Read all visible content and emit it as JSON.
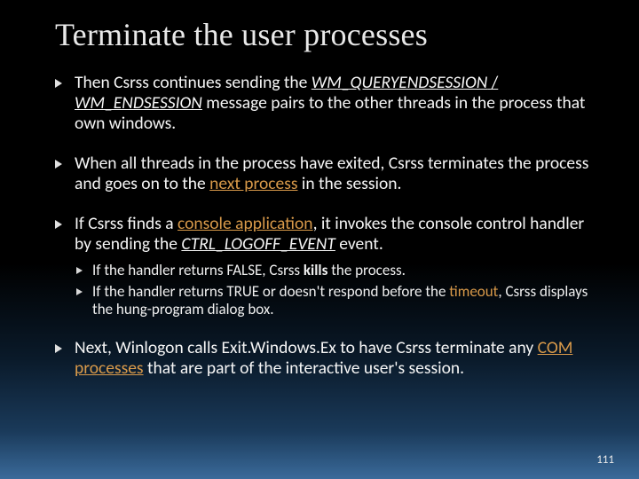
{
  "title": "Terminate the user processes",
  "bullets": {
    "b1": {
      "t0": "Then Csrss continues sending the ",
      "code1": "WM_QUERYENDSESSION",
      "slash": " / ",
      "code2": "WM_ENDSESSION",
      "t1": " message pairs to the other threads in the process that own windows."
    },
    "b2": {
      "t0": "When all threads in the process have exited, Csrss terminates the process and goes on to the ",
      "hl": "next process",
      "t1": " in the session."
    },
    "b3": {
      "t0": "If Csrss finds a ",
      "hl": "console application",
      "t1": ", it invokes the console control handler by sending the ",
      "code": "CTRL_LOGOFF_EVENT",
      "t2": " event.",
      "sub1": {
        "t0": "If the handler returns FALSE, Csrss ",
        "bold": "kills",
        "t1": " the process."
      },
      "sub2": {
        "t0": "If the handler returns TRUE or doesn't respond before the ",
        "hl": "timeout",
        "t1": ", Csrss displays the hung-program dialog box."
      }
    },
    "b4": {
      "t0": "Next, Winlogon calls Exit.Windows.Ex to have Csrss terminate any ",
      "hl": "COM processes",
      "t1": " that are part of the interactive user's session."
    }
  },
  "page_number": "111"
}
